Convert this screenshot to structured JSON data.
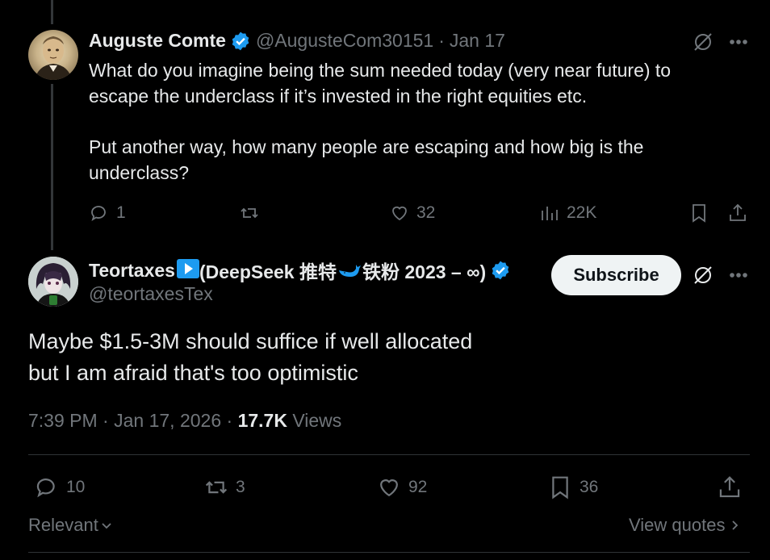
{
  "tweet1": {
    "name": "Auguste Comte",
    "handle": "@AugusteCom30151",
    "separator": "·",
    "date": "Jan 17",
    "text_line1": "What do you imagine being the sum needed today (very near future) to",
    "text_line2": "escape the underclass if it’s invested in the right equities etc.",
    "text_line3": "Put another way, how many people are escaping and how big is the",
    "text_line4": "underclass?",
    "replies": "1",
    "reposts": "",
    "likes": "32",
    "views": "22K"
  },
  "tweet2": {
    "name_part1": "Teortaxes",
    "name_part2": " (DeepSeek 推特",
    "name_part3": "铁粉 2023 – ∞)",
    "handle": "@teortaxesTex",
    "subscribe_label": "Subscribe",
    "text_line1": "Maybe $1.5-3M should suffice if well allocated",
    "text_line2": "but I am afraid that's too optimistic",
    "time": "7:39 PM",
    "separator": " · ",
    "date": "Jan 17, 2026",
    "views_count": "17.7K",
    "views_label": " Views",
    "replies": "10",
    "reposts": "3",
    "likes": "92",
    "bookmarks": "36"
  },
  "footer": {
    "sort_label": "Relevant",
    "view_quotes_label": "View quotes"
  },
  "colors": {
    "background": "#000000",
    "text": "#e7e9ea",
    "muted": "#71767b",
    "verified": "#1d9bf0"
  }
}
